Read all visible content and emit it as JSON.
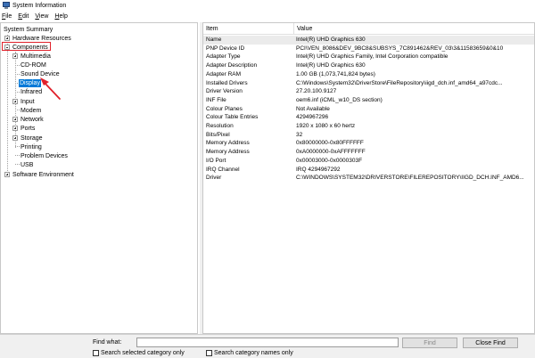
{
  "window": {
    "title": "System Information"
  },
  "menu": [
    {
      "label": "File",
      "accel": "F",
      "rest": "ile"
    },
    {
      "label": "Edit",
      "accel": "E",
      "rest": "dit"
    },
    {
      "label": "View",
      "accel": "V",
      "rest": "iew"
    },
    {
      "label": "Help",
      "accel": "H",
      "rest": "elp"
    }
  ],
  "tree": {
    "root": "System Summary",
    "hardware": "Hardware Resources",
    "components": "Components",
    "multimedia": "Multimedia",
    "cdrom": "CD-ROM",
    "sound": "Sound Device",
    "display": "Display",
    "infrared": "Infrared",
    "input": "Input",
    "modem": "Modem",
    "network": "Network",
    "ports": "Ports",
    "storage": "Storage",
    "printing": "Printing",
    "problem": "Problem Devices",
    "usb": "USB",
    "software": "Software Environment"
  },
  "details": {
    "col_item": "Item",
    "col_value": "Value",
    "rows": [
      {
        "item": "Name",
        "value": "Intel(R) UHD Graphics 630"
      },
      {
        "item": "PNP Device ID",
        "value": "PCI\\VEN_8086&DEV_9BC8&SUBSYS_7C891462&REV_03\\3&11583659&0&10"
      },
      {
        "item": "Adapter Type",
        "value": "Intel(R) UHD Graphics Family, Intel Corporation compatible"
      },
      {
        "item": "Adapter Description",
        "value": "Intel(R) UHD Graphics 630"
      },
      {
        "item": "Adapter RAM",
        "value": "1.00 GB (1,073,741,824 bytes)"
      },
      {
        "item": "Installed Drivers",
        "value": "C:\\Windows\\System32\\DriverStore\\FileRepository\\iigd_dch.inf_amd64_a97cdc..."
      },
      {
        "item": "Driver Version",
        "value": "27.20.100.9127"
      },
      {
        "item": "INF File",
        "value": "oem6.inf (iCML_w10_DS section)"
      },
      {
        "item": "Colour Planes",
        "value": "Not Available"
      },
      {
        "item": "Colour Table Entries",
        "value": "4294967296"
      },
      {
        "item": "Resolution",
        "value": "1920 x 1080 x 60 hertz"
      },
      {
        "item": "Bits/Pixel",
        "value": "32"
      },
      {
        "item": "Memory Address",
        "value": "0x80000000-0x80FFFFFF"
      },
      {
        "item": "Memory Address",
        "value": "0xA0000000-0xAFFFFFFF"
      },
      {
        "item": "I/O Port",
        "value": "0x00003000-0x0000303F"
      },
      {
        "item": "IRQ Channel",
        "value": "IRQ 4294967292"
      },
      {
        "item": "Driver",
        "value": "C:\\WINDOWS\\SYSTEM32\\DRIVERSTORE\\FILEREPOSITORY\\IIGD_DCH.INF_AMD6..."
      }
    ]
  },
  "find": {
    "label": "Find what:",
    "find_button": "Find",
    "close_button": "Close Find",
    "search_selected": "Search selected category only",
    "search_names": "Search category names only"
  },
  "colors": {
    "selection": "#0078d7",
    "annotation_red": "#e0202a"
  }
}
